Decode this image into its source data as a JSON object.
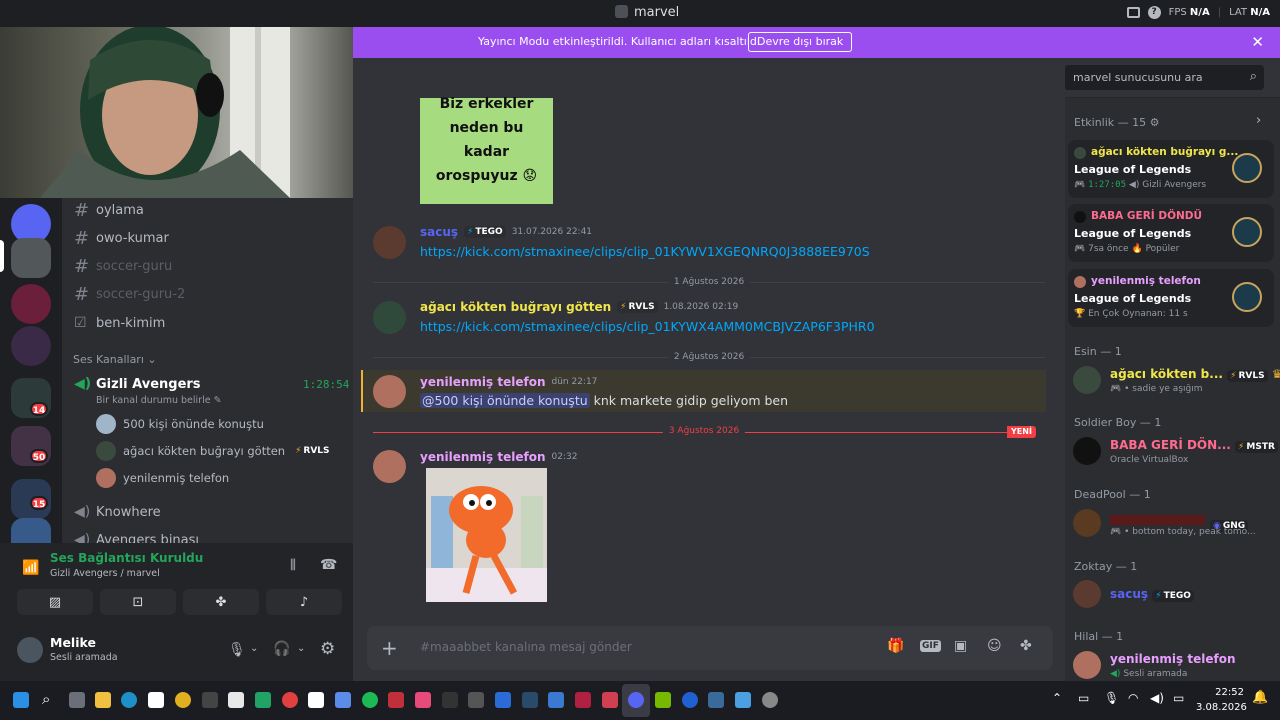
{
  "window": {
    "title": "marvel",
    "fps_label": "FPS",
    "fps_value": "N/A",
    "lat_label": "LAT",
    "lat_value": "N/A"
  },
  "notice": {
    "text": "Yayıncı Modu etkinleştirildi. Kullanıcı adları kısaltıldı.",
    "button": "Devre dışı bırak",
    "color": "#9b4ef0"
  },
  "guild_badges": [
    "14",
    "50",
    "15"
  ],
  "channels": {
    "text": [
      {
        "name": "oylama"
      },
      {
        "name": "owo-kumar"
      },
      {
        "name": "soccer-guru"
      },
      {
        "name": "soccer-guru-2"
      },
      {
        "name": "ben-kimim"
      }
    ],
    "voice_category": "Ses Kanalları",
    "voice_channel": {
      "name": "Gizli Avengers",
      "timer": "1:28:54",
      "status": "Bir kanal durumu belirle"
    },
    "voice_users": [
      {
        "name": "500 kişi önünde konuştu",
        "tag": ""
      },
      {
        "name": "ağacı kökten buğrayı götten",
        "tag": "RVLS"
      },
      {
        "name": "yenilenmiş telefon",
        "tag": ""
      }
    ],
    "other_voice": [
      "Knowhere",
      "Avengers binası"
    ]
  },
  "voice_panel": {
    "status": "Ses Bağlantısı Kuruldu",
    "location": "Gizli Avengers / marvel"
  },
  "user_panel": {
    "name": "Melike",
    "status": "Sesli aramada"
  },
  "chat": {
    "channel": "maaabbet",
    "search_placeholder": "marvel sunucusunu ara",
    "image_text": [
      "Biz erkekler",
      "neden bu",
      "kadar",
      "orospuyuz"
    ],
    "messages": [
      {
        "author": "sacuş",
        "tag": "TEGO",
        "time": "31.07.2026 22:41",
        "content": "https://kick.com/stmaxinee/clips/clip_01KYWV1XGEQNRQ0J3888EE970S"
      },
      {
        "author": "ağacı kökten buğrayı götten",
        "tag": "RVLS",
        "time": "1.08.2026 02:19",
        "content": "https://kick.com/stmaxinee/clips/clip_01KYWX4AMM0MCBJVZAP6F3PHR0"
      },
      {
        "author": "yenilenmiş telefon",
        "tag": "",
        "time": "dün 22:17",
        "mention": "@500 kişi önünde konuştu",
        "content": " knk markete gidip geliyom ben"
      },
      {
        "author": "yenilenmiş telefon",
        "tag": "",
        "time": "02:32",
        "content": ""
      }
    ],
    "dates": [
      "1 Ağustos 2026",
      "2 Ağustos 2026",
      "3 Ağustos 2026"
    ],
    "new_label": "YENİ",
    "composer_placeholder": "#maaabbet kanalına mesaj gönder"
  },
  "members": {
    "activity_header": "Etkinlik — 15",
    "activities": [
      {
        "user": "ağacı kökten buğrayı g...",
        "game": "League of Legends",
        "detail": "1:27:05",
        "detail2": "Gizli Avengers"
      },
      {
        "user": "BABA GERİ DÖNDÜ",
        "game": "League of Legends",
        "detail": "7sa önce",
        "detail2": "Popüler"
      },
      {
        "user": "yenilenmiş telefon",
        "game": "League of Legends",
        "detail": "En Çok Oynanan: 11 s",
        "detail2": ""
      }
    ],
    "groups": [
      {
        "header": "Esin — 1",
        "name": "ağacı kökten b...",
        "tag": "RVLS",
        "status": "• sadie ye aşığım"
      },
      {
        "header": "Soldier Boy — 1",
        "name": "BABA GERİ DÖN...",
        "tag": "MSTR",
        "status": "Oracle VirtualBox"
      },
      {
        "header": "DeadPool — 1",
        "name": "",
        "tag": "GNG",
        "status": "• bottom today, peak tomo..."
      },
      {
        "header": "Zoktay — 1",
        "name": "sacuş",
        "tag": "TEGO",
        "status": ""
      },
      {
        "header": "Hilal — 1",
        "name": "yenilenmiş telefon",
        "tag": "",
        "status": "Sesli aramada"
      }
    ]
  },
  "taskbar": {
    "time": "22:52",
    "date": "3.08.2026"
  }
}
